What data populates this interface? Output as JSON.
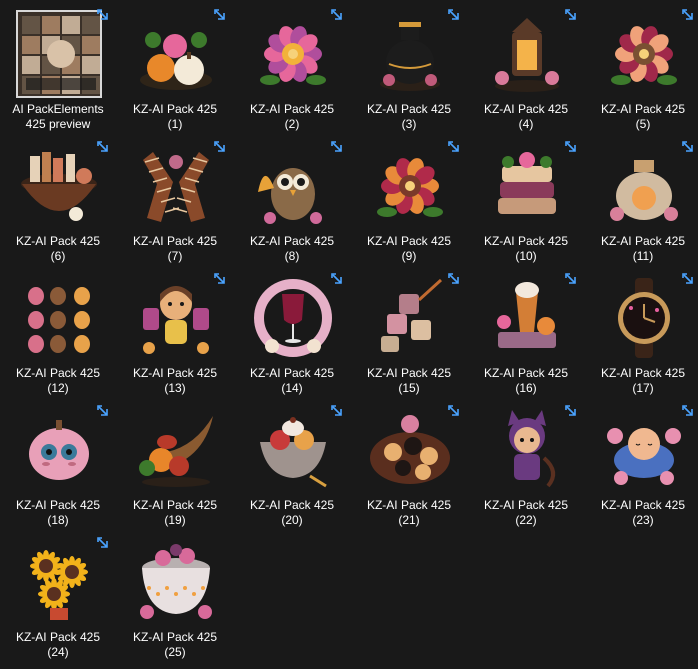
{
  "explorer": {
    "items": [
      {
        "name_line1": "AI PackElements",
        "name_line2": "425  preview",
        "kind": "preview",
        "shortcut": true,
        "colors": [
          "#6b5a4a",
          "#b08a6a",
          "#d9c2a8"
        ]
      },
      {
        "name_line1": "KZ-AI Pack 425",
        "name_line2": "(1)",
        "kind": "pumpkins",
        "shortcut": true,
        "colors": [
          "#e8882a",
          "#f3ead8",
          "#3d7a2c"
        ]
      },
      {
        "name_line1": "KZ-AI Pack 425",
        "name_line2": "(2)",
        "kind": "flower",
        "shortcut": true,
        "colors": [
          "#e6679b",
          "#b04e9c",
          "#f2b23a"
        ]
      },
      {
        "name_line1": "KZ-AI Pack 425",
        "name_line2": "(3)",
        "kind": "vase",
        "shortcut": true,
        "colors": [
          "#1c1c1c",
          "#d49a3a",
          "#c05a7a"
        ]
      },
      {
        "name_line1": "KZ-AI Pack 425",
        "name_line2": "(4)",
        "kind": "lantern",
        "shortcut": true,
        "colors": [
          "#5a3a28",
          "#f4b34a",
          "#d97a9a"
        ]
      },
      {
        "name_line1": "KZ-AI Pack 425",
        "name_line2": "(5)",
        "kind": "flower",
        "shortcut": true,
        "colors": [
          "#f0a27a",
          "#a0284a",
          "#7a5032"
        ]
      },
      {
        "name_line1": "KZ-AI Pack 425",
        "name_line2": "(6)",
        "kind": "basket",
        "shortcut": true,
        "colors": [
          "#6a3a22",
          "#e6d2b8",
          "#d07a5a"
        ]
      },
      {
        "name_line1": "KZ-AI Pack 425",
        "name_line2": "(7)",
        "kind": "scarf",
        "shortcut": true,
        "colors": [
          "#8a4a2a",
          "#e8c8a0",
          "#c06a8a"
        ]
      },
      {
        "name_line1": "KZ-AI Pack 425",
        "name_line2": "(8)",
        "kind": "owl",
        "shortcut": true,
        "colors": [
          "#8a6a48",
          "#e8a238",
          "#d06a9a"
        ]
      },
      {
        "name_line1": "KZ-AI Pack 425",
        "name_line2": "(9)",
        "kind": "flower",
        "shortcut": true,
        "colors": [
          "#b02a4a",
          "#e88a3a",
          "#7a3a2a"
        ]
      },
      {
        "name_line1": "KZ-AI Pack 425",
        "name_line2": "(10)",
        "kind": "sweaters",
        "shortcut": true,
        "colors": [
          "#c69a7a",
          "#8a3a5a",
          "#e6c6a0"
        ]
      },
      {
        "name_line1": "KZ-AI Pack 425",
        "name_line2": "(11)",
        "kind": "jar",
        "shortcut": true,
        "colors": [
          "#f2d8b8",
          "#f0a050",
          "#d8809a"
        ]
      },
      {
        "name_line1": "KZ-AI Pack 425",
        "name_line2": "(12)",
        "kind": "sheet",
        "shortcut": false,
        "colors": [
          "#d8708a",
          "#8a5a38",
          "#e8a24a"
        ]
      },
      {
        "name_line1": "KZ-AI Pack 425",
        "name_line2": "(13)",
        "kind": "doll",
        "shortcut": true,
        "colors": [
          "#6a4028",
          "#e8b07a",
          "#b04a8a"
        ]
      },
      {
        "name_line1": "KZ-AI Pack 425",
        "name_line2": "(14)",
        "kind": "wine",
        "shortcut": true,
        "colors": [
          "#8a1a3a",
          "#e6b0c8",
          "#f2e2d0"
        ]
      },
      {
        "name_line1": "KZ-AI Pack 425",
        "name_line2": "(15)",
        "kind": "cubes",
        "shortcut": true,
        "colors": [
          "#e8a0b0",
          "#c06a30",
          "#f2d2b0"
        ]
      },
      {
        "name_line1": "KZ-AI Pack 425",
        "name_line2": "(16)",
        "kind": "drink",
        "shortcut": true,
        "colors": [
          "#f2e8dc",
          "#e88a3a",
          "#9a6a88"
        ]
      },
      {
        "name_line1": "KZ-AI Pack 425",
        "name_line2": "(17)",
        "kind": "watch",
        "shortcut": true,
        "colors": [
          "#3a2418",
          "#c89a5a",
          "#e860a0"
        ]
      },
      {
        "name_line1": "KZ-AI Pack 425",
        "name_line2": "(18)",
        "kind": "pumpkin-face",
        "shortcut": true,
        "colors": [
          "#e8a0b8",
          "#3a7a9a",
          "#c06a80"
        ]
      },
      {
        "name_line1": "KZ-AI Pack 425",
        "name_line2": "(19)",
        "kind": "cornucopia",
        "shortcut": false,
        "colors": [
          "#e8862a",
          "#b83a2a",
          "#7a4a2a"
        ]
      },
      {
        "name_line1": "KZ-AI Pack 425",
        "name_line2": "(20)",
        "kind": "dessert",
        "shortcut": true,
        "colors": [
          "#f2e8e0",
          "#c83a3a",
          "#e8a24a"
        ]
      },
      {
        "name_line1": "KZ-AI Pack 425",
        "name_line2": "(21)",
        "kind": "tray",
        "shortcut": true,
        "colors": [
          "#5a2e1e",
          "#e8b070",
          "#d880a0"
        ]
      },
      {
        "name_line1": "KZ-AI Pack 425",
        "name_line2": "(22)",
        "kind": "girl",
        "shortcut": true,
        "colors": [
          "#6a3a80",
          "#e8b890",
          "#5a3020"
        ]
      },
      {
        "name_line1": "KZ-AI Pack 425",
        "name_line2": "(23)",
        "kind": "cushion",
        "shortcut": true,
        "colors": [
          "#e890b0",
          "#f0b890",
          "#4a70c0"
        ]
      },
      {
        "name_line1": "KZ-AI Pack 425",
        "name_line2": "(24)",
        "kind": "sunflower",
        "shortcut": true,
        "colors": [
          "#f2b21a",
          "#5a3020",
          "#c84a30"
        ]
      },
      {
        "name_line1": "KZ-AI Pack 425",
        "name_line2": "(25)",
        "kind": "pot",
        "shortcut": false,
        "colors": [
          "#e8e0e0",
          "#d86a9a",
          "#f0a040"
        ]
      }
    ],
    "shortcut_color": "#4aa3ff"
  }
}
